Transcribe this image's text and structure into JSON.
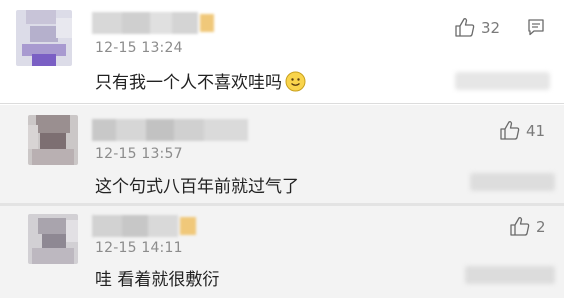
{
  "comments": [
    {
      "date": "12-15 13:24",
      "text": "只有我一个人不喜欢哇吗",
      "likes": "32",
      "emoji": "smiley-emoji",
      "has_reply_icon": true
    },
    {
      "date": "12-15 13:57",
      "text": "这个句式八百年前就过气了",
      "likes": "41"
    },
    {
      "date": "12-15 14:11",
      "text": "哇 看着就很敷衍",
      "likes": "2"
    }
  ],
  "icons": {
    "like": "thumbs-up-icon",
    "reply": "comment-bubble-icon"
  },
  "colors": {
    "text": "#222222",
    "meta": "#8c8c8c",
    "highlight_bg": "#f3f3f3"
  }
}
